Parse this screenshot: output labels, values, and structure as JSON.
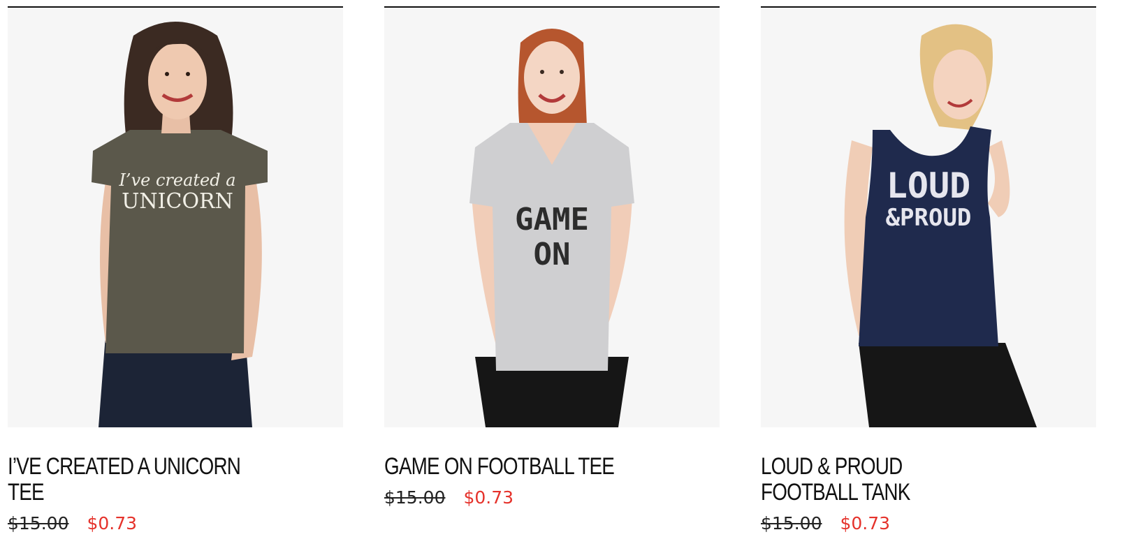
{
  "products": [
    {
      "title_lines": [
        "I’VE CREATED A UNICORN",
        "TEE"
      ],
      "shirt_text_lines": [
        "I’ve created a",
        "UNICORN"
      ],
      "old_price": "$15.00",
      "sale_price": "$0.73",
      "shirt_color": "#5b584b"
    },
    {
      "title_lines": [
        "GAME ON FOOTBALL TEE"
      ],
      "shirt_text_lines": [
        "GAME",
        "ON"
      ],
      "old_price": "$15.00",
      "sale_price": "$0.73",
      "shirt_color": "#cfcfd1"
    },
    {
      "title_lines": [
        "LOUD & PROUD",
        "FOOTBALL TANK"
      ],
      "shirt_text_lines": [
        "LOUD",
        "&PROUD"
      ],
      "old_price": "$15.00",
      "sale_price": "$0.73",
      "shirt_color": "#1f2a4d"
    }
  ],
  "colors": {
    "sale": "#e5322b",
    "title": "#111111",
    "image_bg": "#f6f6f6"
  }
}
